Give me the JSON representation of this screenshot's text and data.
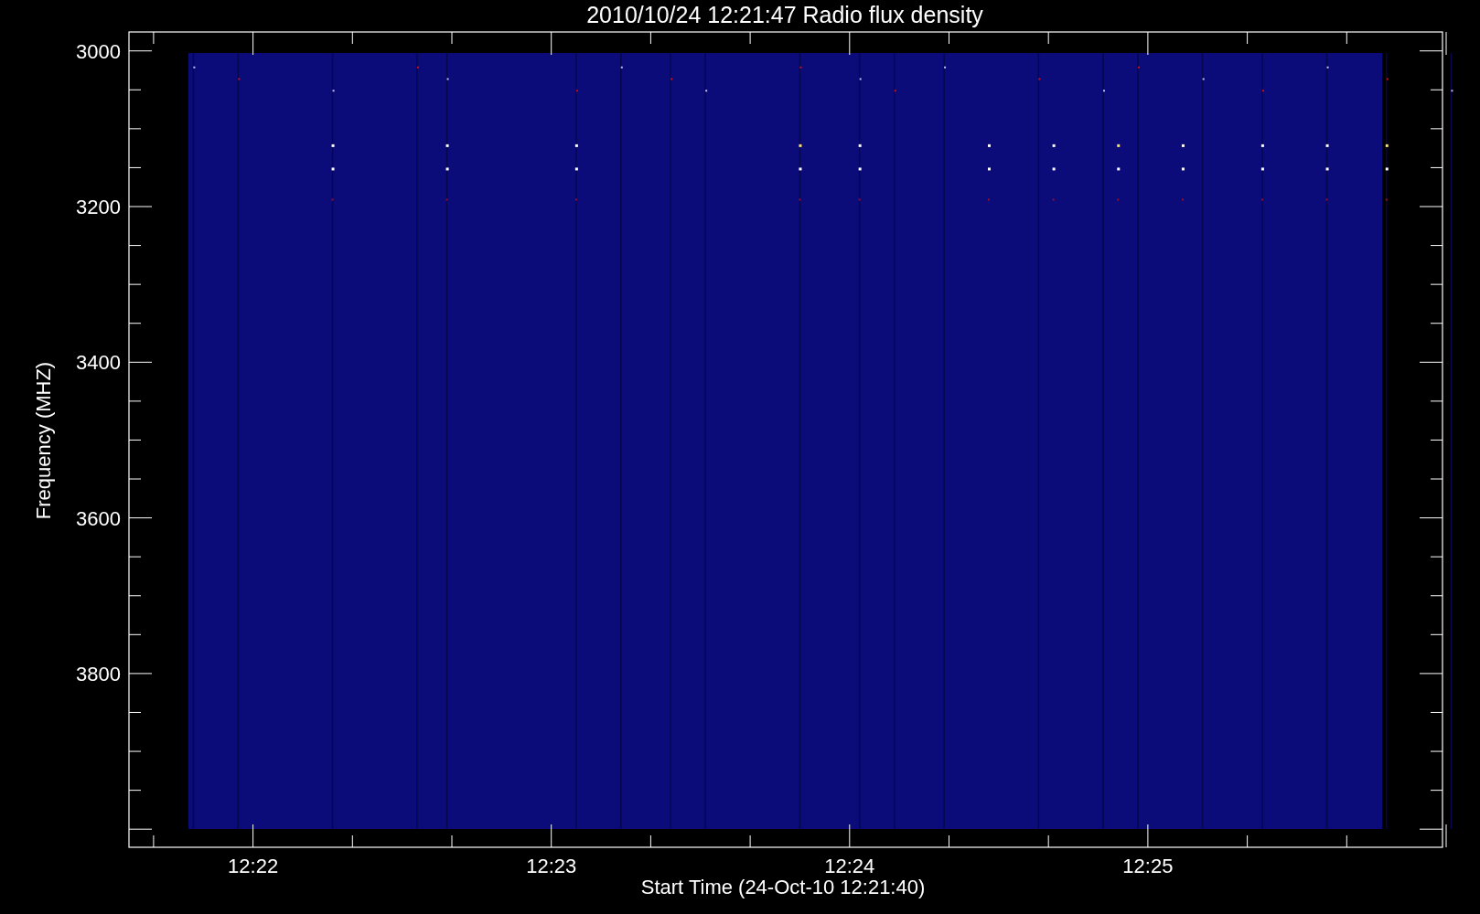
{
  "title": "2010/10/24 12:21:47 Radio flux density",
  "y_axis": {
    "label": "Frequency (MHZ)",
    "ticks": [
      "3000",
      "3200",
      "3400",
      "3600",
      "3800"
    ]
  },
  "x_axis": {
    "label": "Start Time (24-Oct-10 12:21:40)",
    "ticks": [
      "12:22",
      "12:23",
      "12:24",
      "12:25"
    ]
  }
}
